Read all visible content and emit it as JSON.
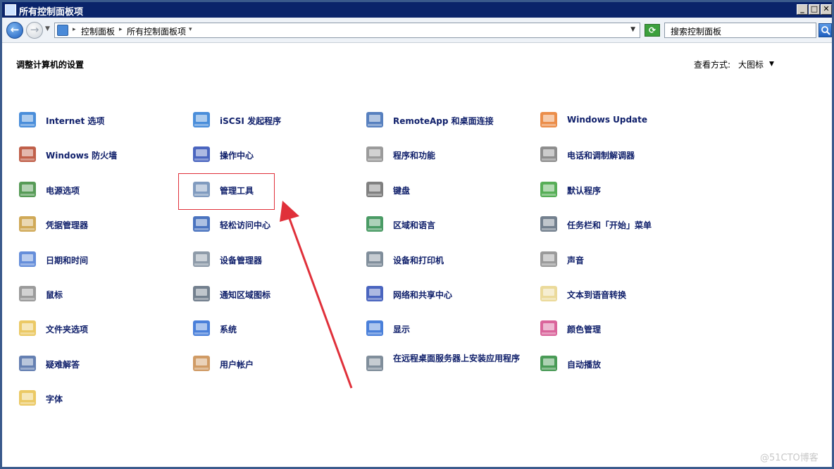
{
  "window": {
    "title": "所有控制面板项",
    "buttons": {
      "minimize": "_",
      "maximize": "□",
      "close": "✕"
    }
  },
  "navbar": {
    "back_icon": "←",
    "forward_icon": "→",
    "breadcrumbs": [
      "控制面板",
      "所有控制面板项"
    ],
    "search_placeholder": "搜索控制面板"
  },
  "header": {
    "heading": "调整计算机的设置",
    "view_label": "查看方式:",
    "view_value": "大图标"
  },
  "items": [
    {
      "label": "Internet 选项",
      "icon": "globe-check-icon",
      "color": "#2a7ad4"
    },
    {
      "label": "Windows 防火墙",
      "icon": "firewall-brick-icon",
      "color": "#b5442a"
    },
    {
      "label": "电源选项",
      "icon": "battery-plug-icon",
      "color": "#3a8a3a"
    },
    {
      "label": "凭据管理器",
      "icon": "vault-icon",
      "color": "#c89a3a"
    },
    {
      "label": "日期和时间",
      "icon": "calendar-clock-icon",
      "color": "#4a7ad4"
    },
    {
      "label": "鼠标",
      "icon": "mouse-icon",
      "color": "#8a8a8a"
    },
    {
      "label": "文件夹选项",
      "icon": "folder-check-icon",
      "color": "#e8c04a"
    },
    {
      "label": "疑难解答",
      "icon": "troubleshoot-icon",
      "color": "#4a6aa4"
    },
    {
      "label": "字体",
      "icon": "font-folder-icon",
      "color": "#e8c04a"
    },
    {
      "label": "iSCSI 发起程序",
      "icon": "globe-shield-icon",
      "color": "#2a7ad4"
    },
    {
      "label": "操作中心",
      "icon": "flag-icon",
      "color": "#2a4ab4"
    },
    {
      "label": "管理工具",
      "icon": "admin-tools-icon",
      "color": "#6a8ab4"
    },
    {
      "label": "轻松访问中心",
      "icon": "accessibility-icon",
      "color": "#2a5ab4"
    },
    {
      "label": "设备管理器",
      "icon": "device-manager-icon",
      "color": "#7a8a9a"
    },
    {
      "label": "通知区域图标",
      "icon": "notification-area-icon",
      "color": "#5a6a7a"
    },
    {
      "label": "系统",
      "icon": "system-monitor-icon",
      "color": "#2a6ad4"
    },
    {
      "label": "用户帐户",
      "icon": "user-accounts-icon",
      "color": "#c88a4a"
    },
    {
      "label": "RemoteApp 和桌面连接",
      "icon": "remoteapp-icon",
      "color": "#3a6ab4"
    },
    {
      "label": "程序和功能",
      "icon": "programs-icon",
      "color": "#8a8a8a"
    },
    {
      "label": "键盘",
      "icon": "keyboard-icon",
      "color": "#6a6a6a"
    },
    {
      "label": "区域和语言",
      "icon": "globe-clock-icon",
      "color": "#2a8a4a"
    },
    {
      "label": "设备和打印机",
      "icon": "printer-icon",
      "color": "#6a7a8a"
    },
    {
      "label": "网络和共享中心",
      "icon": "network-icon",
      "color": "#2a4ab4"
    },
    {
      "label": "显示",
      "icon": "display-icon",
      "color": "#2a6ad4"
    },
    {
      "label": "在远程桌面服务器上安装应用程序",
      "icon": "remote-install-icon",
      "color": "#6a7a8a"
    },
    {
      "label": "Windows Update",
      "icon": "windows-update-icon",
      "color": "#e87a2a"
    },
    {
      "label": "电话和调制解调器",
      "icon": "phone-modem-icon",
      "color": "#7a7a7a"
    },
    {
      "label": "默认程序",
      "icon": "default-programs-icon",
      "color": "#3aa03a"
    },
    {
      "label": "任务栏和「开始」菜单",
      "icon": "taskbar-icon",
      "color": "#5a6a7a"
    },
    {
      "label": "声音",
      "icon": "speaker-icon",
      "color": "#8a8a8a"
    },
    {
      "label": "文本到语音转换",
      "icon": "speech-bubble-icon",
      "color": "#e8d48a"
    },
    {
      "label": "颜色管理",
      "icon": "color-management-icon",
      "color": "#d44a8a"
    },
    {
      "label": "自动播放",
      "icon": "autoplay-icon",
      "color": "#2a8a3a"
    }
  ],
  "annotation": {
    "highlight_color": "#e0303a"
  },
  "watermark": "@51CTO博客"
}
